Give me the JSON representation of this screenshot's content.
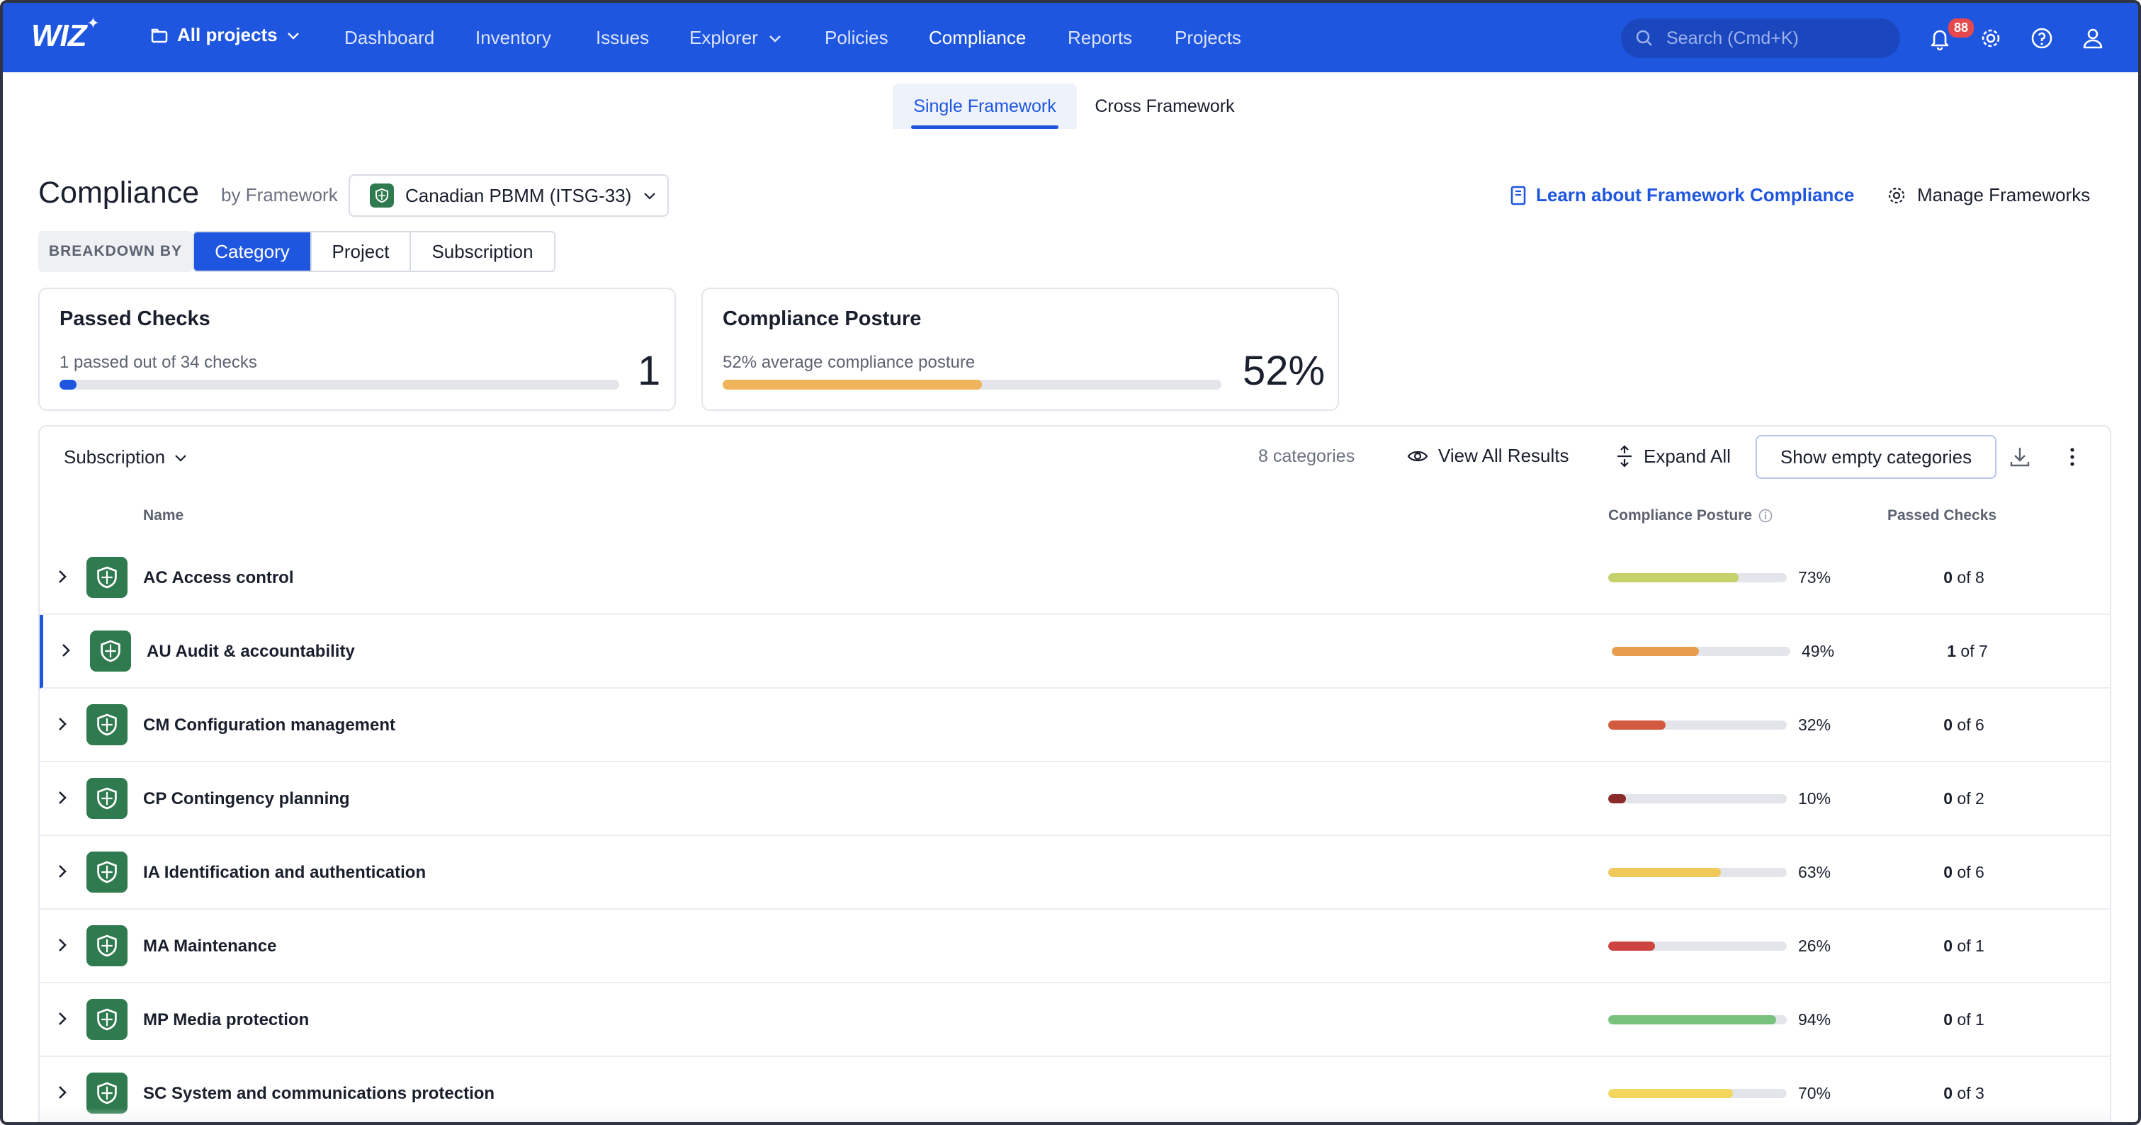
{
  "nav": {
    "logo": "WIZ",
    "project_selector": "All projects",
    "items": [
      "Dashboard",
      "Inventory",
      "Issues",
      "Explorer",
      "Policies",
      "Compliance",
      "Reports",
      "Projects"
    ],
    "active": "Compliance",
    "search_placeholder": "Search (Cmd+K)",
    "notifications_count": "88"
  },
  "framework_tabs": {
    "single": "Single Framework",
    "cross": "Cross Framework",
    "active": "Single Framework"
  },
  "header": {
    "title": "Compliance",
    "by_label": "by Framework",
    "framework": "Canadian PBMM (ITSG-33)",
    "learn_link": "Learn about Framework Compliance",
    "manage_button": "Manage Frameworks"
  },
  "breakdown": {
    "label": "BREAKDOWN BY",
    "options": [
      "Category",
      "Project",
      "Subscription"
    ],
    "selected": "Category"
  },
  "cards": {
    "passed": {
      "title": "Passed Checks",
      "subtitle": "1 passed out of 34 checks",
      "value": "1",
      "progress": 0.03,
      "color": "#1f56e0"
    },
    "posture": {
      "title": "Compliance Posture",
      "subtitle": "52% average compliance posture",
      "value": "52%",
      "progress": 0.52,
      "color": "#f0b45c"
    }
  },
  "toolbar": {
    "group_by": "Subscription",
    "category_count": "8 categories",
    "view_all": "View All Results",
    "expand_all": "Expand All",
    "show_empty": "Show empty categories"
  },
  "columns": {
    "name": "Name",
    "posture": "Compliance Posture",
    "passed": "Passed Checks"
  },
  "rows": [
    {
      "name": "AC Access control",
      "pct": "73%",
      "value": 0.73,
      "color": "#c5d16a",
      "passed": "0",
      "total": "of 8"
    },
    {
      "name": "AU Audit & accountability",
      "pct": "49%",
      "value": 0.49,
      "color": "#e79d4e",
      "passed": "1",
      "total": "of 7"
    },
    {
      "name": "CM Configuration management",
      "pct": "32%",
      "value": 0.32,
      "color": "#d45a3f",
      "passed": "0",
      "total": "of 6"
    },
    {
      "name": "CP Contingency planning",
      "pct": "10%",
      "value": 0.1,
      "color": "#8b2a2a",
      "passed": "0",
      "total": "of 2"
    },
    {
      "name": "IA Identification and authentication",
      "pct": "63%",
      "value": 0.63,
      "color": "#f0c95a",
      "passed": "0",
      "total": "of 6"
    },
    {
      "name": "MA Maintenance",
      "pct": "26%",
      "value": 0.26,
      "color": "#cc4440",
      "passed": "0",
      "total": "of 1"
    },
    {
      "name": "MP Media protection",
      "pct": "94%",
      "value": 0.94,
      "color": "#78c27e",
      "passed": "0",
      "total": "of 1"
    },
    {
      "name": "SC System and communications protection",
      "pct": "70%",
      "value": 0.7,
      "color": "#f3d65e",
      "passed": "0",
      "total": "of 3"
    }
  ]
}
